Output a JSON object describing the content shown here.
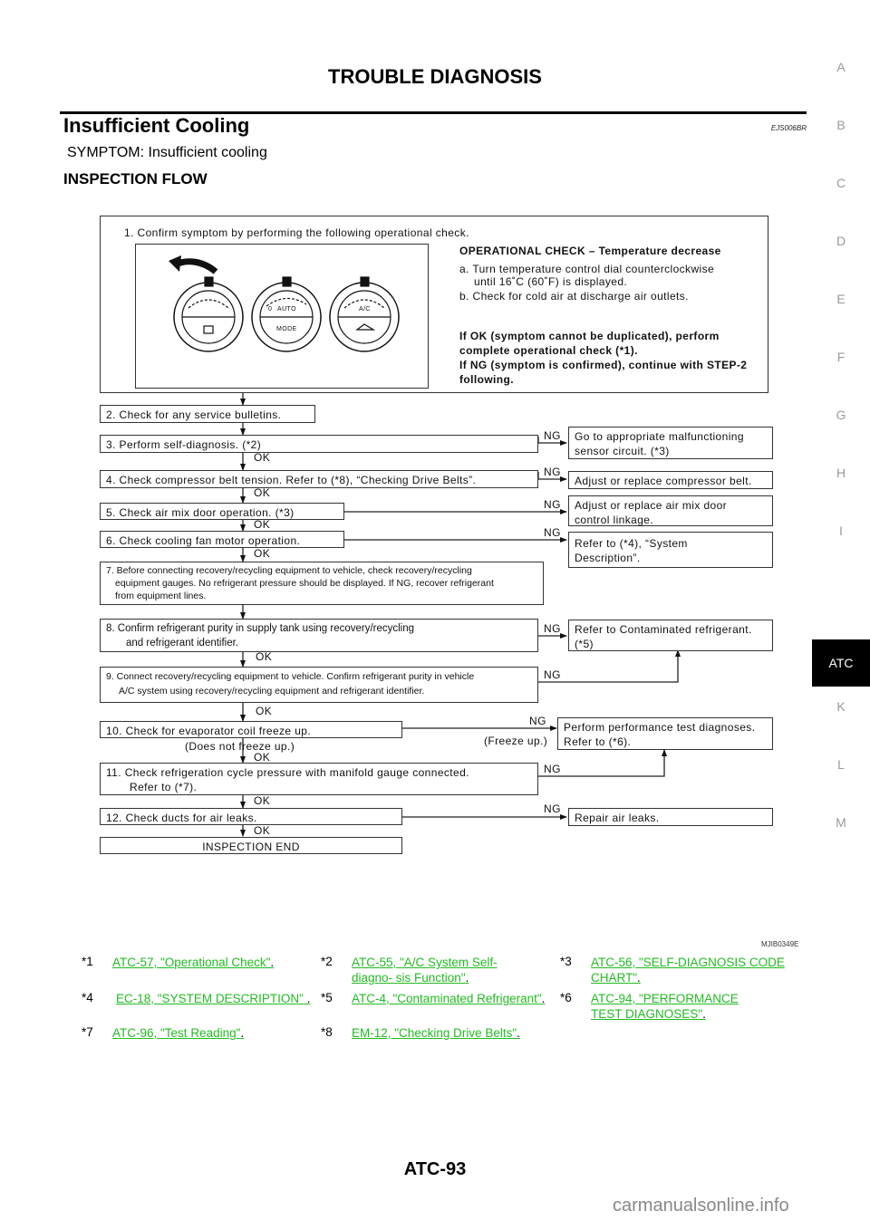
{
  "header": {
    "title": "TROUBLE DIAGNOSIS",
    "section_title": "Insufficient Cooling",
    "section_code": "EJS006BR",
    "symptom": "SYMPTOM: Insufficient cooling",
    "flow_heading": "INSPECTION FLOW"
  },
  "side_tabs": [
    "A",
    "B",
    "C",
    "D",
    "E",
    "F",
    "G",
    "H",
    "I",
    "ATC",
    "K",
    "L",
    "M"
  ],
  "side_tab_active": "ATC",
  "flow": {
    "step1": {
      "title": "1. Confirm symptom by performing the following operational check.",
      "check_title": "OPERATIONAL CHECK – Temperature decrease",
      "line_a1": "a. Turn temperature control dial counterclockwise",
      "line_a2": "until 16˚C (60˚F) is displayed.",
      "line_b": "b. Check for cold air at discharge air outlets.",
      "result1": "If OK (symptom cannot be duplicated), perform",
      "result2": "complete operational check (*1).",
      "result3": "If NG (symptom is confirmed), continue with STEP-2",
      "result4": "following.",
      "dial_labels": {
        "auto": "AUTO",
        "mode": "MODE",
        "zero": "0",
        "ac": "A/C"
      }
    },
    "steps": {
      "s2": "2. Check for any service bulletins.",
      "s3": "3. Perform self-diagnosis. (*2)",
      "s4": "4.  Check compressor belt tension. Refer to (*8), “Checking Drive Belts”.",
      "s5": "5. Check air mix door operation. (*3)",
      "s6": "6. Check cooling fan motor operation.",
      "s7a": "7. Before connecting recovery/recycling equipment to vehicle, check recovery/recycling",
      "s7b": "equipment gauges. No refrigerant pressure should be displayed. If NG, recover refrigerant",
      "s7c": "from equipment lines.",
      "s8a": "8.    Confirm refrigerant purity in supply tank using recovery/recycling",
      "s8b": "and refrigerant identifier.",
      "s9a": "9. Connect recovery/recycling equipment to vehicle. Confirm refrigerant purity in vehicle",
      "s9b": "A/C system using recovery/recycling equipment and refrigerant identifier.",
      "s10": "10.  Check for evaporator coil freeze up.",
      "s11a": "11.  Check refrigeration cycle pressure with manifold gauge connected.",
      "s11b": "Refer to (*7).",
      "s12": "12.  Check ducts for air leaks.",
      "end": "INSPECTION END"
    },
    "results": {
      "r3a": "Go to appropriate malfunctioning",
      "r3b": "sensor circuit. (*3)",
      "r4": "Adjust or replace compressor belt.",
      "r5a": "Adjust or replace air mix door",
      "r5b": "control linkage.",
      "r6a": "Refer to (*4), “System",
      "r6b": "Description”.",
      "r8a": "Refer to Contaminated refrigerant.",
      "r8b": "(*5)",
      "r10a": "Perform performance test diagnoses.",
      "r10b": "Refer to (*6).",
      "r12": "Repair air leaks."
    },
    "labels": {
      "ok": "OK",
      "ng": "NG",
      "freeze_up": "(Freeze up.)",
      "no_freeze": "(Does not freeze up.)"
    }
  },
  "figure_code": "MJIB0349E",
  "references": [
    {
      "num": "*1",
      "link": "ATC-57, \"Operational Check\"",
      "tail": "."
    },
    {
      "num": "*2",
      "link": "ATC-55, \"A/C System Self-diagno- sis Function\"",
      "tail": "."
    },
    {
      "num": "*3",
      "link": "ATC-56, \"SELF-DIAGNOSIS CODE CHART\"",
      "tail": "."
    },
    {
      "num": "*4",
      "link": "EC-18, \"SYSTEM DESCRIPTION\"",
      "tail": " ."
    },
    {
      "num": "*5",
      "link": "ATC-4, \"Contaminated Refrigerant\"",
      "tail": "."
    },
    {
      "num": "*6",
      "link": "ATC-94, \"PERFORMANCE TEST DIAGNOSES\"",
      "tail": "."
    },
    {
      "num": "*7",
      "link": "ATC-96, \"Test Reading\"",
      "tail": "."
    },
    {
      "num": "*8",
      "link": "EM-12, \"Checking Drive Belts\"",
      "tail": "."
    }
  ],
  "link_color": "#22bb22",
  "footer": {
    "page_number": "ATC-93",
    "watermark": "carmanualsonline.info"
  }
}
